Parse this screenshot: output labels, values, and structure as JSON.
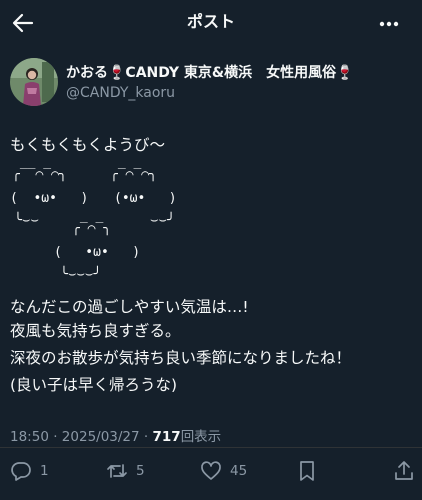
{
  "header": {
    "title": "ポスト",
    "back_icon": "arrow-left-icon",
    "more_icon": "more-horizontal-icon"
  },
  "author": {
    "display_name": "かおる🍷CANDY 東京&横浜　女性用風俗🍷",
    "handle": "@CANDY_kaoru"
  },
  "tweet": {
    "intro": "もくもくもくようび〜",
    "clouds": {
      "left_top": "╭‾‾⌒‾⌒╮",
      "left_face": "(  •ω•   )",
      "left_bottom": "╰⌣⌣",
      "right_top": "╭‾⌒‾⌒╮",
      "right_face": "(•ω•   )",
      "right_bottom": "⌣⌣╯",
      "mid_top": "╭‾⌒‾╮",
      "mid_face": "(   •ω•   )",
      "mid_bottom": "╰⌣⌣⌣╯"
    },
    "lines": [
      "なんだこの過ごしやすい気温は…!",
      "夜風も気持ち良すぎる。",
      "深夜のお散歩が気持ち良い季節になりましたね！",
      "(良い子は早く帰ろうな)"
    ]
  },
  "meta": {
    "time": "18:50",
    "separator": "·",
    "date": "2025/03/27",
    "views": "717",
    "views_label": "回表示"
  },
  "actions": {
    "reply_count": "1",
    "retweet_count": "5",
    "like_count": "45",
    "icons": [
      "reply-icon",
      "retweet-icon",
      "like-icon",
      "bookmark-icon",
      "share-icon"
    ]
  },
  "colors": {
    "background": "#15202b",
    "text": "#f7f9f9",
    "muted": "#8b98a5"
  }
}
